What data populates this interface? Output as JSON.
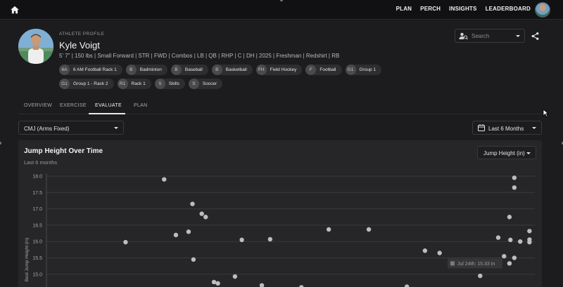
{
  "nav": {
    "items": [
      "PLAN",
      "PERCH",
      "INSIGHTS",
      "LEADERBOARD"
    ]
  },
  "profile": {
    "eyebrow": "ATHLETE PROFILE",
    "name": "Kyle Voigt",
    "details": "5' 7\" | 150 lbs | Small Forward | STR | FWD | Combos | LB | QB | RHP | C | DH | 2025 | Freshman | Redshirt | RB",
    "groups": [
      {
        "abbr": "6A",
        "label": "6 AM Football Rack 1"
      },
      {
        "abbr": "B",
        "label": "Badminton"
      },
      {
        "abbr": "B",
        "label": "Baseball"
      },
      {
        "abbr": "B",
        "label": "Basketball"
      },
      {
        "abbr": "FH",
        "label": "Field Hockey"
      },
      {
        "abbr": "F",
        "label": "Football"
      },
      {
        "abbr": "G1",
        "label": "Group 1"
      },
      {
        "abbr": "G1",
        "label": "Group 1 - Rack 2"
      },
      {
        "abbr": "R1",
        "label": "Rack 1"
      },
      {
        "abbr": "S",
        "label": "Skills"
      },
      {
        "abbr": "S",
        "label": "Soccer"
      }
    ]
  },
  "search": {
    "placeholder": "Search"
  },
  "tabs": [
    "OVERVIEW",
    "EXERCISE",
    "EVALUATE",
    "PLAN"
  ],
  "active_tab": "EVALUATE",
  "filters": {
    "test": "CMJ (Arms Fixed)",
    "range": "Last 6 Months"
  },
  "chart": {
    "title": "Jump Height Over Time",
    "subtitle": "Last 6 months",
    "metric": "Jump Height (in)",
    "tooltip": "Jul 24th: 15.33 in"
  },
  "chart_data": {
    "type": "scatter",
    "title": "Jump Height Over Time",
    "ylabel": "Best Jump Height (in)",
    "xlabel": "",
    "ylim": [
      14.5,
      18.0
    ],
    "yticks": [
      18.0,
      17.5,
      17.0,
      16.5,
      16.0,
      15.5,
      15.0
    ],
    "xlim": [
      0,
      100
    ],
    "grid": true,
    "point_color": "#bdbdbd",
    "series": [
      {
        "x": [
          24.1,
          16.2,
          29.9,
          26.5,
          31.8,
          29.1,
          32.6,
          40.0,
          30.1,
          34.3,
          35.1,
          38.6,
          44.1,
          52.2,
          66.0,
          77.5,
          80.5,
          88.8,
          92.5,
          95.8,
          95.8,
          94.8,
          95.8,
          95.0,
          93.7,
          94.8,
          98.9,
          98.9,
          98.9,
          94.8,
          45.8,
          57.8,
          73.8,
          97.0
        ],
        "y": [
          17.9,
          15.98,
          17.15,
          16.2,
          16.85,
          16.3,
          16.75,
          16.05,
          15.45,
          14.76,
          14.72,
          14.93,
          14.66,
          14.6,
          16.37,
          15.72,
          15.65,
          14.95,
          16.12,
          17.95,
          17.65,
          16.75,
          15.5,
          16.05,
          15.55,
          15.33,
          16.32,
          16.06,
          15.98,
          15.33,
          16.07,
          16.37,
          14.62,
          16.0
        ]
      }
    ]
  }
}
